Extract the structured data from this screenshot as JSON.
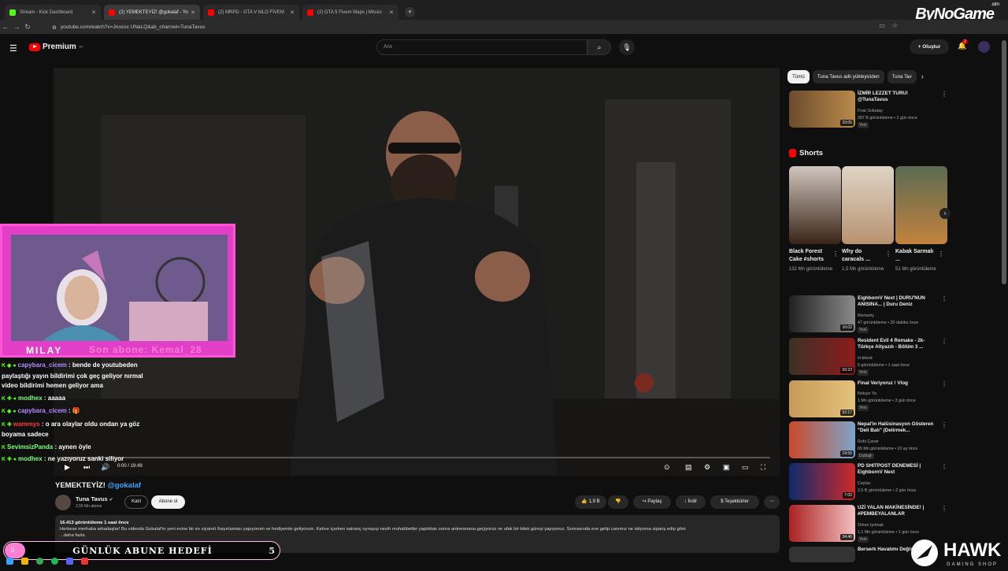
{
  "browser": {
    "tabs": [
      {
        "label": "Stream - Kick Dashboard",
        "fav": "#53fc18"
      },
      {
        "label": "(2) YEMEKTEYİZ! @gokalaf - Yo",
        "fav": "#ff0000"
      },
      {
        "label": "(2) MRPD - GTA V MLO FİVEM",
        "fav": "#ff0000"
      },
      {
        "label": "(2) GTA 5 Fivem Maps | Missio",
        "fav": "#ff0000"
      }
    ],
    "url": "youtube.com/watch?v=Jnossx UNaLQ&ab_channel=TunaTavus",
    "watermark": "ByNoGame",
    "watermark_small": ".com"
  },
  "header": {
    "logo": "Premium",
    "logo_sup": "TR",
    "search_placeholder": "Ara",
    "create": "Oluştur",
    "notif": "2"
  },
  "player": {
    "time": "0:00 / 19:49"
  },
  "stream": {
    "name": "MILAY",
    "last_sub": "Son abone: Kemal_28",
    "chat": [
      {
        "user": "capybara_cicem",
        "color": "#b78cff",
        "text": ": bende de youtubeden paylaştığı yayın bildirimi çok geç geliyor nırmal video bildirimi hemen geliyor ama"
      },
      {
        "user": "modhex",
        "color": "#7dff7d",
        "text": ": aaaaa"
      },
      {
        "user": "capybara_cicem",
        "color": "#b78cff",
        "text": ": 🎁"
      },
      {
        "user": "wammys",
        "color": "#ff3b3b",
        "text": ": o ara olaylar oldu ondan ya göz boyama sadece"
      },
      {
        "user": "SevimsizPanda",
        "color": "#7dff7d",
        "text": ": aynen öyle"
      },
      {
        "user": "modhex",
        "color": "#7dff7d",
        "text": ": ne yazıyoruz sanki siliyor"
      }
    ],
    "goal_count": "0",
    "goal_title": "GÜNLÜK ABUNE HEDEFİ",
    "goal_target": "5"
  },
  "video": {
    "title_main": "YEMEKTEYİZ!",
    "title_tag": "@gokalaf",
    "channel": "Tuna Tavus",
    "subs": "2,55 Mn abone",
    "join": "Katıl",
    "subscribe": "Abone ol",
    "likes": "1,9 B",
    "share": "Paylaş",
    "download": "İndir",
    "thanks": "Teşekkürler",
    "views": "16.413 görüntüleme",
    "ago": "1 saat önce",
    "desc": "Herkese merhaba arkadaşlar! Bu videoda Gokalaf'ın yeni evine bir ev ziyareti /hayırlaması yapıyorum ve hediyemle geliyorum. Kahve içerken satranç oynayıp nezih muhabbetler yaptıktan sonra antrenmana geçiyoruz ve ufak bir bilek güreşi yapıyoruz. Sonrasında eve gelip canımız ne istiyorsa sipariş edip göm",
    "more": "...daha fazla"
  },
  "sidebar": {
    "chips": [
      "Tümü",
      "Tuna Tavus adlı yükleyiciden",
      "Tuna Tav"
    ],
    "first": {
      "title": "İZMİR LEZZET TURU! @TunaTavus",
      "channel": "Fırat Sobutay",
      "meta": "287 B görüntüleme • 2 gün önce",
      "dur": "33:05",
      "badge": "Yeni"
    },
    "shorts_title": "Shorts",
    "shorts": [
      {
        "title": "Black Forest Cake #shorts",
        "views": "132 Mn görüntüleme"
      },
      {
        "title": "Why do caracals ...",
        "views": "1,5 Mn görüntüleme"
      },
      {
        "title": "Kabak Sarmalı ...",
        "views": "51 Mn görüntüleme"
      }
    ],
    "videos": [
      {
        "title": "EighbornV Next | DURU'NUN ANISINA... | Duru Deniz",
        "channel": "Rionamy",
        "meta": "47 görüntüleme • 20 dakika önce",
        "badge": "Yeni",
        "dur": "16:02"
      },
      {
        "title": "Resident Evil 4 Remake - 2k- Türkçe Altyazılı - Bölüm 3 ...",
        "channel": "H-blood",
        "meta": "5 görüntüleme • 1 saat önce",
        "badge": "Yeni",
        "dur": "59:22"
      },
      {
        "title": "Final Veriyoruz ! Vlog",
        "channel": "Noluyo Ya",
        "meta": "1 Mn görüntüleme • 3 gün önce",
        "badge": "Yeni",
        "dur": "52:17"
      },
      {
        "title": "Nepal'in Halüsinasyon Gösteren \"Deli Balı\" (Delirmek...",
        "channel": "Ruhi Çenet",
        "meta": "65 Mn görüntüleme • 10 ay önce",
        "badge": "Dublajlı",
        "dur": "19:55"
      },
      {
        "title": "PD SHITPOST DENEMESİ | EighbornV Next",
        "channel": "Ceylan",
        "meta": "2,5 B görüntüleme • 2 gün önce",
        "badge": "",
        "dur": "7:00"
      },
      {
        "title": "UZİ YALAN MAKİNESİNDE! | #PEMBEYALANLAR",
        "channel": "Orkun Işıtmak",
        "meta": "1,1 Mn görüntüleme • 1 gün önce",
        "badge": "Yeni",
        "dur": "34:46"
      },
      {
        "title": "Berserk Havatımı Değiştirdi",
        "channel": "",
        "meta": "",
        "badge": "",
        "dur": ""
      }
    ]
  },
  "overlay": {
    "brand": "HAWK",
    "brand_sub": "GAMING SHOP"
  }
}
